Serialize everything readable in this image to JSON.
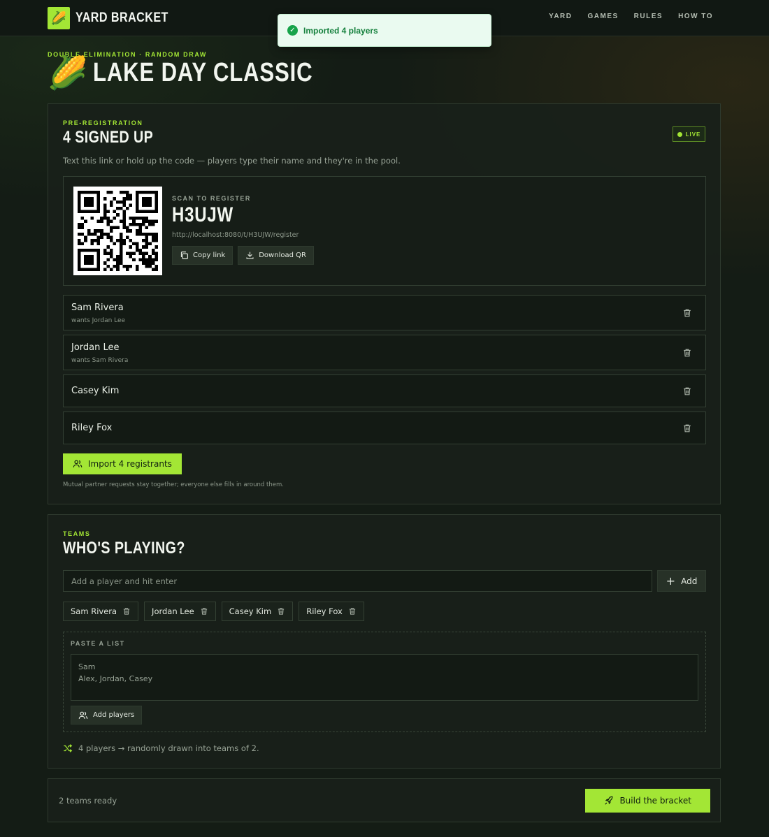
{
  "brand": {
    "name": "YARD BRACKET",
    "logo": "🌽"
  },
  "nav": {
    "items": [
      "YARD",
      "GAMES",
      "RULES",
      "HOW TO"
    ]
  },
  "toast": {
    "message": "Imported 4 players",
    "icon": "check-circle-icon",
    "color": "#16a34a"
  },
  "header": {
    "eyebrow": "DOUBLE ELIMINATION · RANDOM DRAW",
    "emoji": "🌽",
    "title": "LAKE DAY CLASSIC"
  },
  "registration": {
    "eyebrow": "PRE-REGISTRATION",
    "title": "4 SIGNED UP",
    "badge": "LIVE",
    "description": "Text this link or hold up the code — players type their name and they're in the pool.",
    "scan_label": "SCAN TO REGISTER",
    "code": "H3UJW",
    "url": "http://localhost:8080/t/H3UJW/register",
    "copy_label": "Copy link",
    "download_label": "Download QR",
    "registrants": [
      {
        "name": "Sam Rivera",
        "note": "wants Jordan Lee"
      },
      {
        "name": "Jordan Lee",
        "note": "wants Sam Rivera"
      },
      {
        "name": "Casey Kim",
        "note": ""
      },
      {
        "name": "Riley Fox",
        "note": ""
      }
    ],
    "import_label": "Import 4 registrants",
    "footnote": "Mutual partner requests stay together; everyone else fills in around them."
  },
  "teams": {
    "eyebrow": "TEAMS",
    "title": "WHO'S PLAYING?",
    "input_placeholder": "Add a player and hit enter",
    "add_label": "Add",
    "players": [
      "Sam Rivera",
      "Jordan Lee",
      "Casey Kim",
      "Riley Fox"
    ],
    "paste_label": "PASTE A LIST",
    "paste_placeholder": "Sam\nAlex, Jordan, Casey",
    "add_players_label": "Add players",
    "draw_info": "4 players → randomly drawn into teams of 2."
  },
  "footer": {
    "status": "2 teams ready",
    "build_label": "Build the bracket"
  },
  "colors": {
    "accent": "#a3e635",
    "background": "#141c15",
    "card": "#182019"
  }
}
